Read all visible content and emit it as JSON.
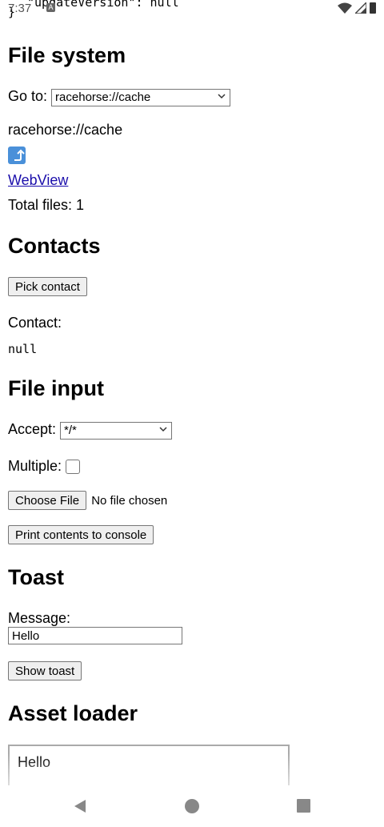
{
  "statusbar": {
    "time": "7:37",
    "peek_text": "\"updateVersion\": null",
    "peek_brace": "}"
  },
  "filesystem": {
    "heading": "File system",
    "goto_label": "Go to:",
    "goto_selected": "racehorse://cache",
    "current_path": "racehorse://cache",
    "up_icon": "up-arrow-icon",
    "webview_link": "WebView",
    "total_files": "Total files: 1"
  },
  "contacts": {
    "heading": "Contacts",
    "pick_button": "Pick contact",
    "contact_label": "Contact:",
    "contact_value": "null"
  },
  "file_input": {
    "heading": "File input",
    "accept_label": "Accept:",
    "accept_selected": "*/*",
    "multiple_label": "Multiple:",
    "choose_button": "Choose File",
    "no_file": "No file chosen",
    "print_button": "Print contents to console"
  },
  "toast": {
    "heading": "Toast",
    "message_label": "Message:",
    "message_value": "Hello",
    "show_button": "Show toast"
  },
  "asset_loader": {
    "heading": "Asset loader",
    "frame_text": "Hello"
  },
  "colors": {
    "link": "#1a0dab",
    "button_bg": "#efefef",
    "up_icon_bg": "#4a90d9"
  }
}
